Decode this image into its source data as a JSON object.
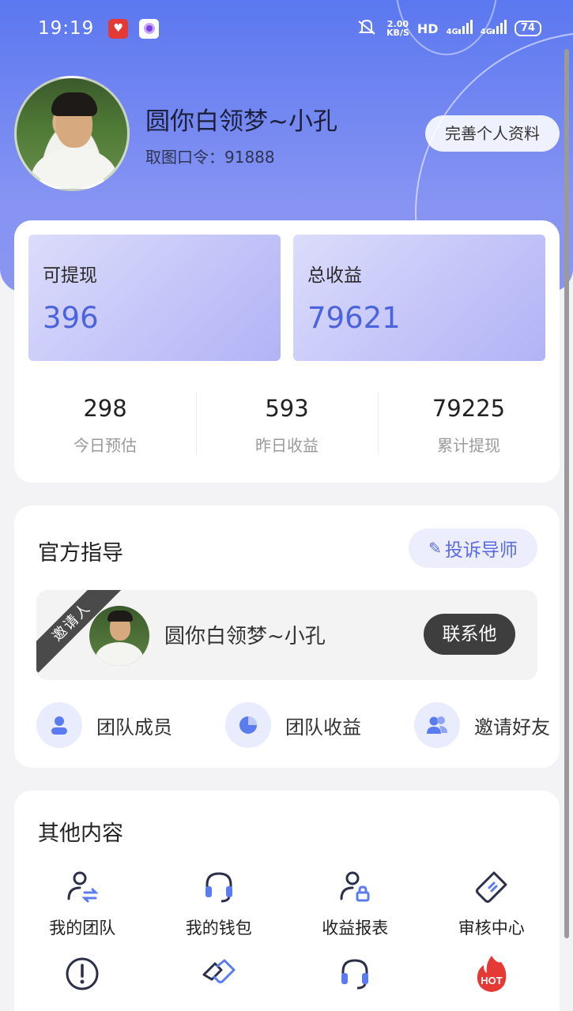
{
  "status_bar": {
    "time": "19:19",
    "speed_value": "2.00",
    "speed_unit": "KB/S",
    "hd": "HD",
    "net1": "4G",
    "net2": "4G",
    "battery": "74"
  },
  "profile": {
    "name": "圆你白领梦~小孔",
    "code": "取图口令：91888",
    "edit_button": "完善个人资料"
  },
  "earnings": {
    "withdrawable_label": "可提现",
    "withdrawable_value": "396",
    "total_label": "总收益",
    "total_value": "79621",
    "stats": [
      {
        "value": "298",
        "label": "今日预估"
      },
      {
        "value": "593",
        "label": "昨日收益"
      },
      {
        "value": "79225",
        "label": "累计提现"
      }
    ]
  },
  "guide": {
    "title": "官方指导",
    "complain_button": "投诉导师",
    "inviter_ribbon": "邀请人",
    "inviter_name": "圆你白领梦~小孔",
    "contact_button": "联系他",
    "team_items": [
      {
        "label": "团队成员",
        "icon": "person-icon"
      },
      {
        "label": "团队收益",
        "icon": "pie-chart-icon"
      },
      {
        "label": "邀请好友",
        "icon": "people-icon"
      }
    ]
  },
  "other": {
    "title": "其他内容",
    "items": [
      {
        "label": "我的团队",
        "icon": "team-transfer-icon"
      },
      {
        "label": "我的钱包",
        "icon": "headset-icon"
      },
      {
        "label": "收益报表",
        "icon": "user-lock-icon"
      },
      {
        "label": "审核中心",
        "icon": "tag-icon"
      },
      {
        "label": "",
        "icon": "alert-icon"
      },
      {
        "label": "",
        "icon": "handshake-icon"
      },
      {
        "label": "",
        "icon": "headset-icon"
      },
      {
        "label": "",
        "icon": "hot-fire-icon"
      }
    ]
  },
  "colors": {
    "header": "#5b78f0",
    "accent": "#4b63dd",
    "icon_blue": "#2f3a8f",
    "hot_red": "#e53935"
  }
}
